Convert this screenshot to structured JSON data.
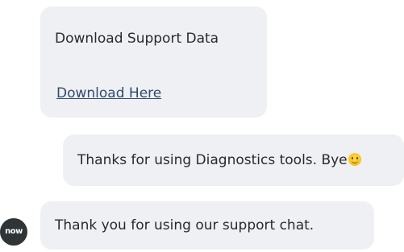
{
  "messages": [
    {
      "title": "Download Support Data",
      "link_label": "Download Here"
    },
    {
      "text": "Thanks for using Diagnostics tools. Bye",
      "emoji": "smiling-face-emoji"
    },
    {
      "text": "Thank you for using our support chat."
    }
  ],
  "avatar": {
    "label": "now",
    "bg_color": "#2f3437"
  },
  "colors": {
    "bubble_bg": "#eef0f3",
    "link": "#2f4b6e"
  }
}
